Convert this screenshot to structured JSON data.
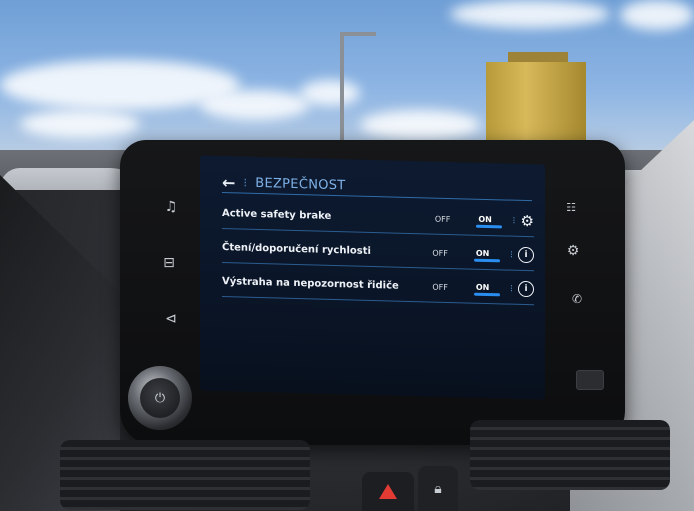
{
  "screen": {
    "header": {
      "back_icon": "arrow-left-icon",
      "title": "BEZPEČNOST"
    },
    "settings": [
      {
        "label": "Active safety brake",
        "toggle_off": "OFF",
        "toggle_on": "ON",
        "state": "on",
        "icon": "gear-icon"
      },
      {
        "label": "Čtení/doporučení rychlosti",
        "toggle_off": "OFF",
        "toggle_on": "ON",
        "state": "on",
        "icon": "info-icon"
      },
      {
        "label": "Výstraha na nepozornost řidiče",
        "toggle_off": "OFF",
        "toggle_on": "ON",
        "state": "on",
        "icon": "info-icon"
      }
    ]
  },
  "side_buttons": {
    "left": [
      "music-icon",
      "car-icon",
      "navigation-icon"
    ],
    "right": [
      "apps-icon",
      "settings-icon",
      "phone-icon"
    ]
  },
  "colors": {
    "screen_bg": "#0a1527",
    "accent_blue": "#2a8ef0",
    "header_text": "#7fb2e8"
  }
}
